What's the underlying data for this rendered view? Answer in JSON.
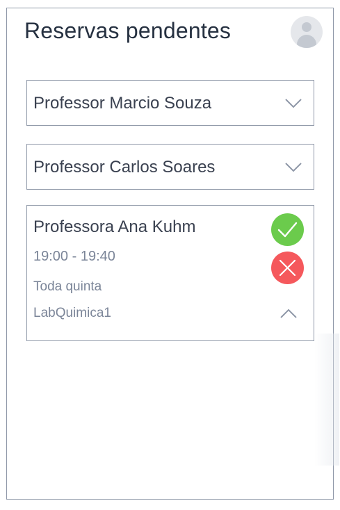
{
  "header": {
    "title": "Reservas pendentes",
    "avatar_icon": "user-avatar-icon"
  },
  "reservations": [
    {
      "professor": "Professor Marcio Souza",
      "expanded": false,
      "toggle_icon": "chevron-down-icon"
    },
    {
      "professor": "Professor Carlos Soares",
      "expanded": false,
      "toggle_icon": "chevron-down-icon"
    },
    {
      "professor": "Professora Ana Kuhm",
      "expanded": true,
      "time": "19:00 - 19:40",
      "recurrence": "Toda quinta",
      "lab": "LabQuimica1",
      "approve_icon": "check-icon",
      "reject_icon": "x-icon",
      "toggle_icon": "chevron-up-icon"
    }
  ],
  "colors": {
    "text_dark": "#263141",
    "text_muted": "#7b8598",
    "border": "#8f98a8",
    "approve": "#6bcb4c",
    "reject": "#f5585c"
  }
}
